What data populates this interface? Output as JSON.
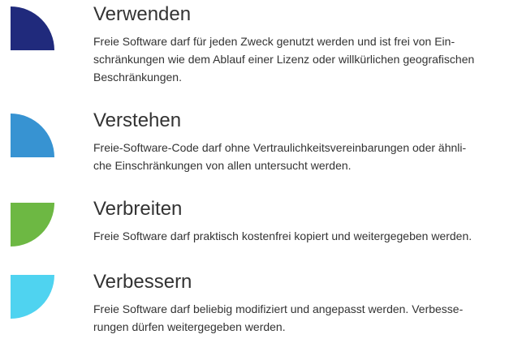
{
  "freedoms": [
    {
      "title": "Verwenden",
      "icon": "dark-blue-quarter-circle-icon",
      "color": "#202a7c",
      "lines": [
        "Freie Software darf für jeden Zweck genutzt werden und ist frei von Ein-",
        "schränkungen wie dem Ablauf einer Lizenz oder willkürlichen geografischen",
        "Beschränkungen."
      ]
    },
    {
      "title": "Verstehen",
      "icon": "blue-quarter-circle-icon",
      "color": "#3793d2",
      "lines": [
        "Freie-Software-Code darf ohne Vertraulichkeitsvereinbarungen oder ähnli-",
        "che Einschränkungen von allen untersucht werden."
      ]
    },
    {
      "title": "Verbreiten",
      "icon": "green-quarter-circle-icon",
      "color": "#6db843",
      "lines": [
        "Freie Software darf praktisch kostenfrei kopiert und weitergegeben werden."
      ]
    },
    {
      "title": "Verbessern",
      "icon": "light-blue-quarter-circle-icon",
      "color": "#4fd3f0",
      "lines": [
        "Freie Software darf beliebig modifiziert und angepasst werden. Verbesse-",
        "rungen dürfen weitergegeben werden."
      ]
    }
  ]
}
